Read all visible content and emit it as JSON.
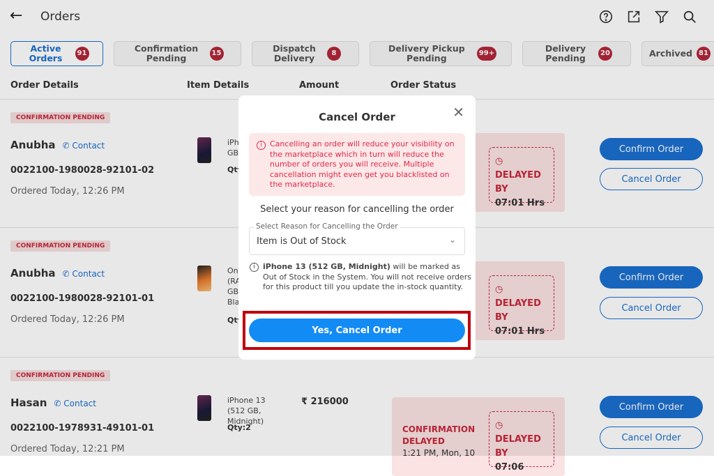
{
  "header": {
    "title": "Orders",
    "icons": [
      "help-icon",
      "export-icon",
      "filter-icon",
      "search-icon"
    ]
  },
  "tabs": [
    {
      "label": "Active Orders",
      "count": "91",
      "active": true
    },
    {
      "label": "Confirmation Pending",
      "count": "15"
    },
    {
      "label": "Dispatch Delivery",
      "count": "8"
    },
    {
      "label": "Delivery Pickup Pending",
      "count": "99+"
    },
    {
      "label": "Delivery Pending",
      "count": "20"
    },
    {
      "label": "Archived",
      "count": "81"
    }
  ],
  "columns": [
    "Order Details",
    "Item Details",
    "Amount",
    "Order Status"
  ],
  "orders": [
    {
      "status": "CONFIRMATION PENDING",
      "name": "Anubha",
      "contact": "Contact",
      "id": "0022100-1980028-92101-02",
      "date": "Ordered Today, 12:26 PM",
      "item": "iPh GB",
      "qty": "Qty",
      "delay_label": "DELAYED BY",
      "delay": "07:01 Hrs",
      "confirm": "Confirm Order",
      "cancel": "Cancel Order"
    },
    {
      "status": "CONFIRMATION PENDING",
      "name": "Anubha",
      "contact": "Contact",
      "id": "0022100-1980028-92101-01",
      "date": "Ordered Today, 12:26 PM",
      "item": "On (RA GB Bla",
      "qty": "Qty",
      "delay_label": "DELAYED BY",
      "delay": "07:01 Hrs",
      "confirm": "Confirm Order",
      "cancel": "Cancel Order"
    },
    {
      "status": "CONFIRMATION PENDING",
      "name": "Hasan",
      "contact": "Contact",
      "id": "0022100-1978931-49101-01",
      "date": "Ordered Today, 12:21 PM",
      "item": "iPhone 13 (512 GB, Midnight)",
      "qty": "Qty:2",
      "amount": "₹ 216000",
      "status_title": "CONFIRMATION DELAYED",
      "status_time": "1:21 PM, Mon, 10",
      "delay_label": "DELAYED BY",
      "delay": "07:06",
      "confirm": "Confirm Order",
      "cancel": "Cancel Order"
    }
  ],
  "modal": {
    "title": "Cancel Order",
    "warning": "Cancelling an order will reduce your visibility on the marketplace which in turn will reduce the number of orders you will receive. Multiple cancellation might even get you blacklisted on the marketplace.",
    "reason_prompt": "Select your reason for cancelling the order",
    "select_label": "Select Reason for Cancelling the Order",
    "select_value": "Item is Out of Stock",
    "info_bold": "iPhone 13 (512 GB, Midnight)",
    "info_rest": " will be marked as Out of Stock in the System. You will not receive orders for this product till you update the in-stock quantity.",
    "confirm_button": "Yes, Cancel Order"
  },
  "colors": {
    "accent": "#1a6fd0",
    "danger": "#c8283c",
    "primary_button": "#138bf5",
    "highlight": "#c0000c"
  }
}
